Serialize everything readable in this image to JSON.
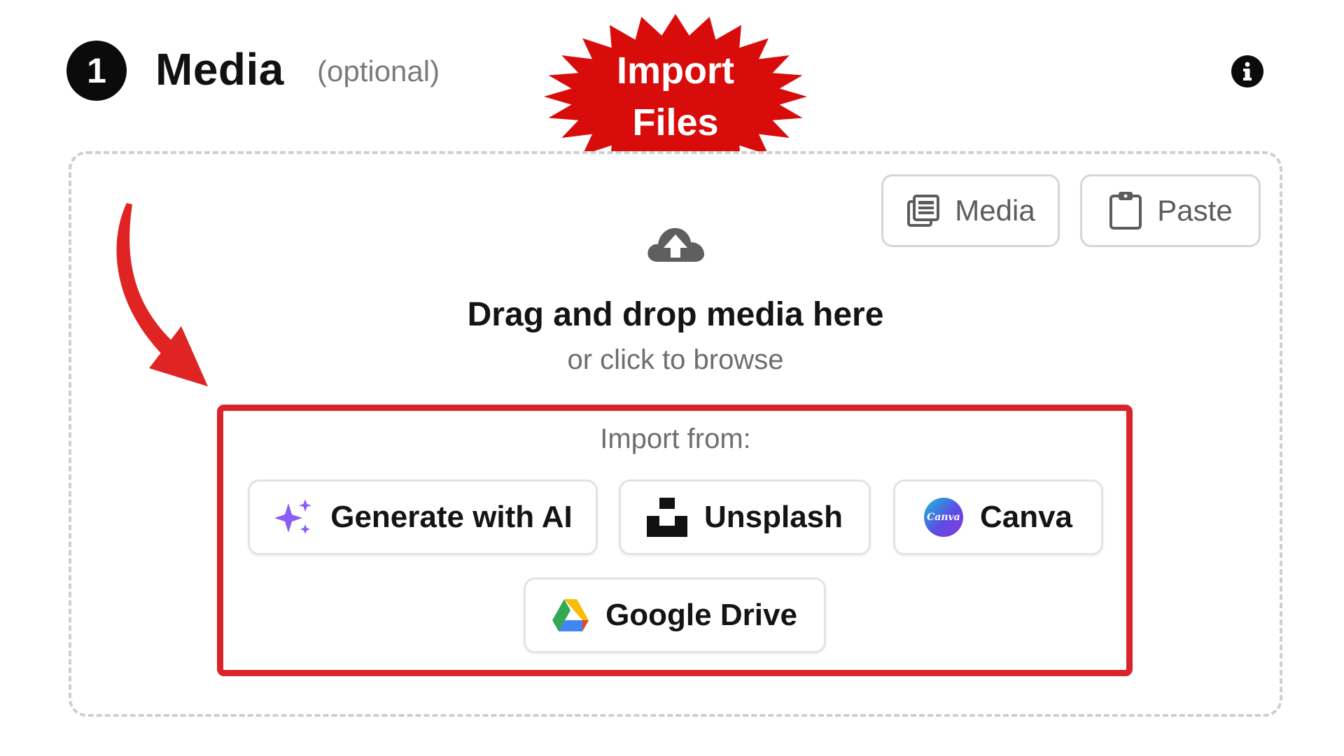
{
  "header": {
    "step_number": "1",
    "title": "Media",
    "optional_label": "(optional)"
  },
  "annotation": {
    "burst_line1": "Import",
    "burst_line2": "Files",
    "burst_color": "#d90c0c",
    "arrow_color": "#e02424",
    "highlight_color": "#d9242c"
  },
  "toolbar": {
    "media_label": "Media",
    "paste_label": "Paste"
  },
  "dropzone": {
    "headline": "Drag and drop media here",
    "subtext": "or click to browse"
  },
  "import_sources": {
    "label": "Import from:",
    "buttons": [
      {
        "label": "Generate with AI",
        "icon": "sparkle-icon"
      },
      {
        "label": "Unsplash",
        "icon": "unsplash-logo-icon"
      },
      {
        "label": "Canva",
        "icon": "canva-logo-icon"
      },
      {
        "label": "Google Drive",
        "icon": "google-drive-logo-icon"
      }
    ],
    "canva_logo_text": "Canva"
  }
}
